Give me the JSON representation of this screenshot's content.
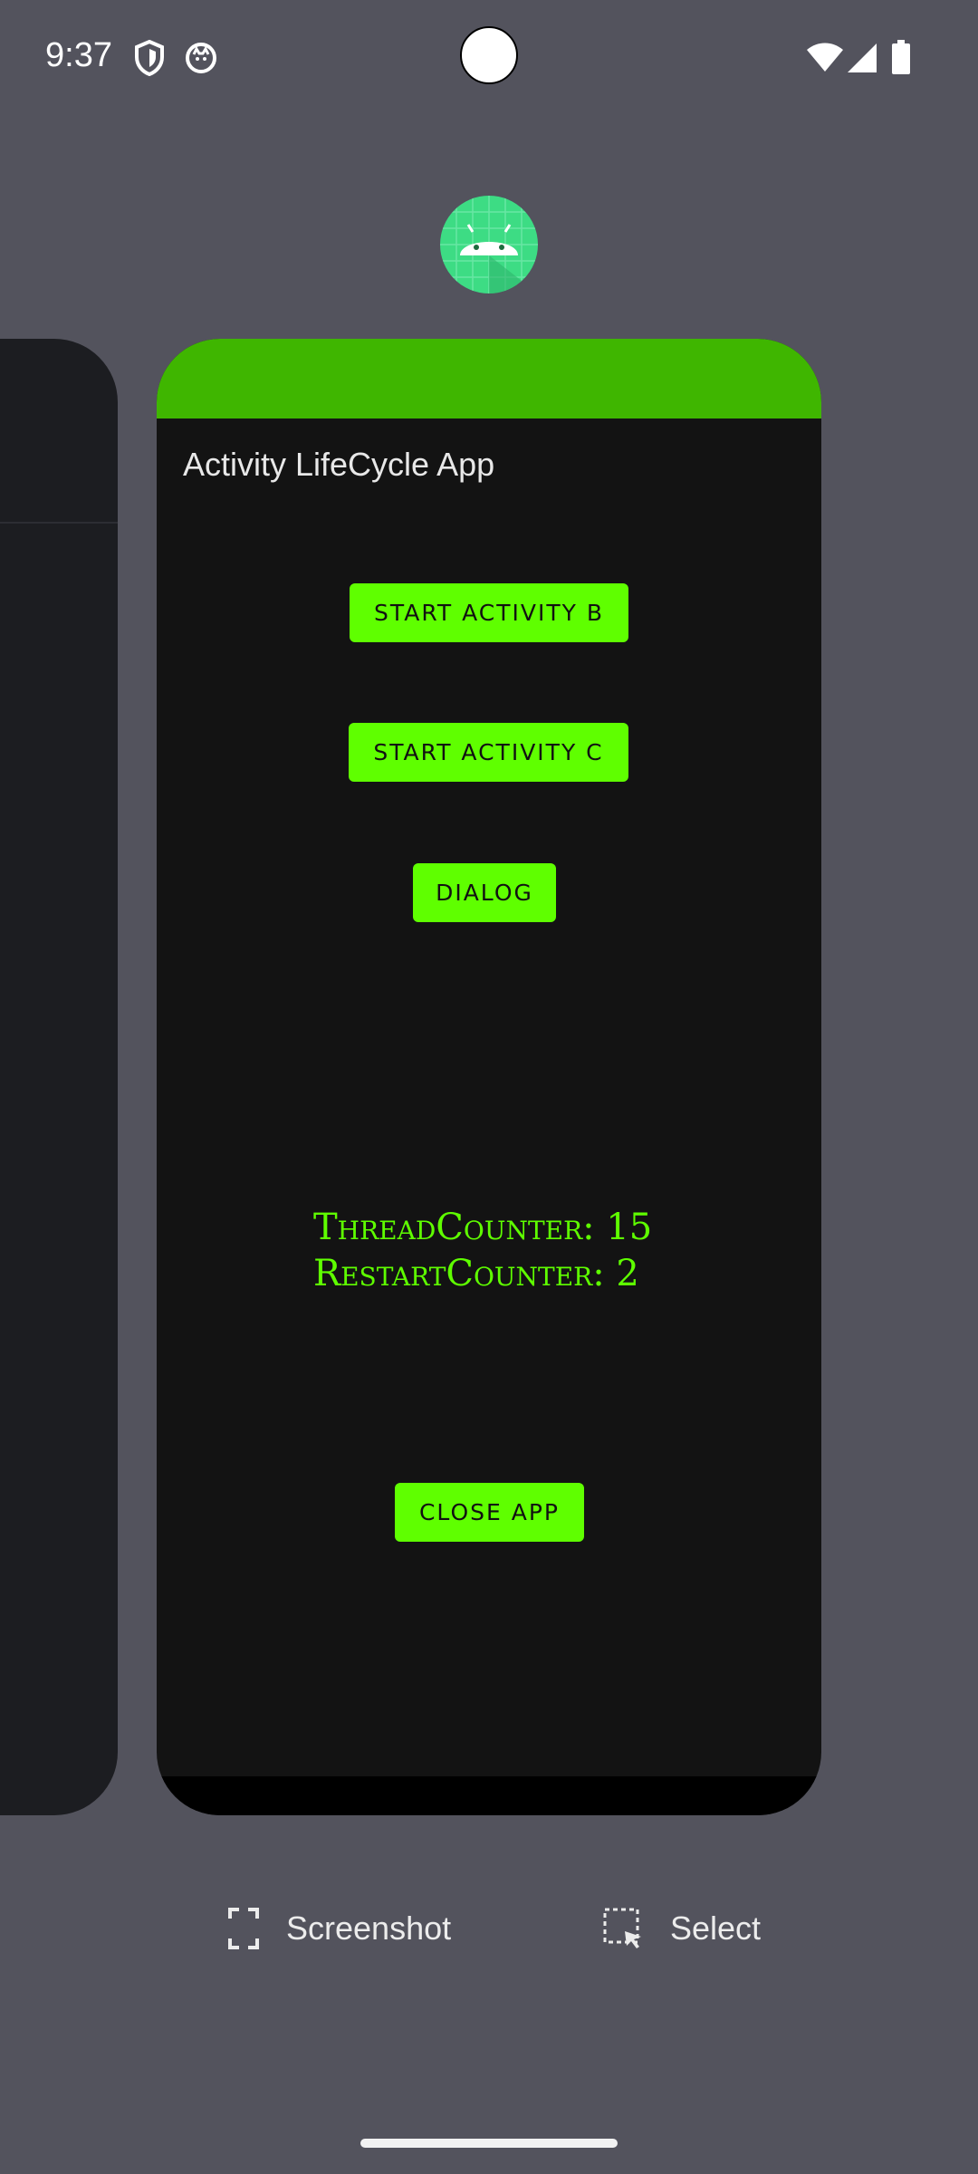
{
  "status_bar": {
    "time": "9:37",
    "icons": [
      "shield-icon",
      "cat-notification-icon",
      "wifi-icon",
      "cellular-signal-icon",
      "battery-icon"
    ]
  },
  "recents": {
    "app_icon": "android-app-icon",
    "card": {
      "accent_color": "#3fb600",
      "button_color": "#5fff00",
      "title": "Activity LifeCycle App",
      "buttons": {
        "start_b": "START ACTIVITY B",
        "start_c": "START ACTIVITY C",
        "dialog": "DIALOG",
        "close": "CLOSE APP"
      },
      "thread_counter": "ThreadCounter: 15",
      "restart_counter": "RestartCounter: 2"
    },
    "actions": {
      "screenshot": "Screenshot",
      "select": "Select"
    }
  }
}
